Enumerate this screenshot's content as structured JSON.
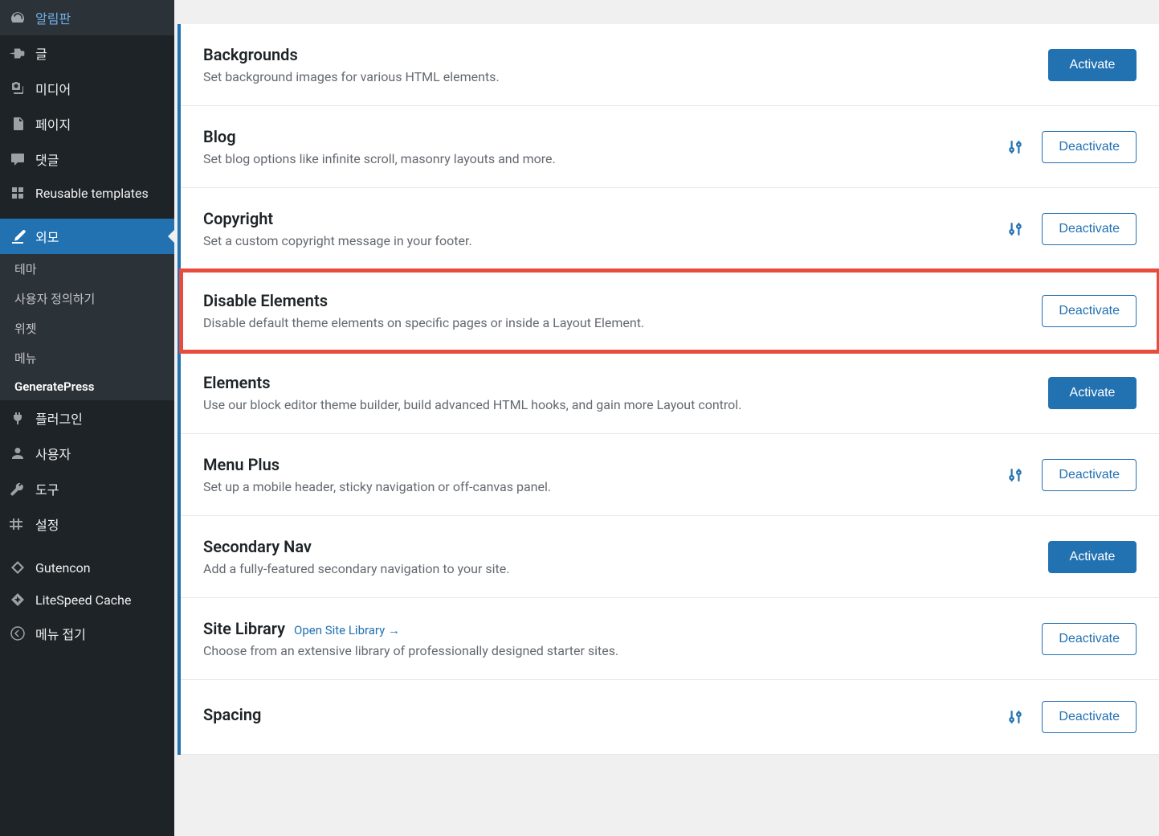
{
  "sidebar": {
    "items": [
      {
        "icon": "dashboard",
        "label": "알림판"
      },
      {
        "icon": "pin",
        "label": "글"
      },
      {
        "icon": "media",
        "label": "미디어"
      },
      {
        "icon": "page",
        "label": "페이지"
      },
      {
        "icon": "comment",
        "label": "댓글"
      },
      {
        "icon": "grid",
        "label": "Reusable templates"
      },
      {
        "icon": "brush",
        "label": "외모",
        "active": true
      },
      {
        "icon": "plugin",
        "label": "플러그인"
      },
      {
        "icon": "user",
        "label": "사용자"
      },
      {
        "icon": "wrench",
        "label": "도구"
      },
      {
        "icon": "settings",
        "label": "설정"
      },
      {
        "icon": "diamond",
        "label": "Gutencon"
      },
      {
        "icon": "bolt",
        "label": "LiteSpeed Cache"
      },
      {
        "icon": "collapse",
        "label": "메뉴 접기"
      }
    ],
    "submenu": [
      {
        "label": "테마"
      },
      {
        "label": "사용자 정의하기"
      },
      {
        "label": "위젯"
      },
      {
        "label": "메뉴"
      },
      {
        "label": "GeneratePress",
        "current": true
      }
    ]
  },
  "buttons": {
    "activate": "Activate",
    "deactivate": "Deactivate"
  },
  "modules": [
    {
      "title": "Backgrounds",
      "desc": "Set background images for various HTML elements.",
      "action": "activate",
      "hasSettings": false,
      "highlighted": false
    },
    {
      "title": "Blog",
      "desc": "Set blog options like infinite scroll, masonry layouts and more.",
      "action": "deactivate",
      "hasSettings": true,
      "highlighted": false
    },
    {
      "title": "Copyright",
      "desc": "Set a custom copyright message in your footer.",
      "action": "deactivate",
      "hasSettings": true,
      "highlighted": false
    },
    {
      "title": "Disable Elements",
      "desc": "Disable default theme elements on specific pages or inside a Layout Element.",
      "action": "deactivate",
      "hasSettings": false,
      "highlighted": true
    },
    {
      "title": "Elements",
      "desc": "Use our block editor theme builder, build advanced HTML hooks, and gain more Layout control.",
      "action": "activate",
      "hasSettings": false,
      "highlighted": false
    },
    {
      "title": "Menu Plus",
      "desc": "Set up a mobile header, sticky navigation or off-canvas panel.",
      "action": "deactivate",
      "hasSettings": true,
      "highlighted": false
    },
    {
      "title": "Secondary Nav",
      "desc": "Add a fully-featured secondary navigation to your site.",
      "action": "activate",
      "hasSettings": false,
      "highlighted": false
    },
    {
      "title": "Site Library",
      "link": "Open Site Library →",
      "desc": "Choose from an extensive library of professionally designed starter sites.",
      "action": "deactivate",
      "hasSettings": false,
      "highlighted": false
    },
    {
      "title": "Spacing",
      "desc": "",
      "action": "deactivate",
      "hasSettings": true,
      "highlighted": false
    }
  ]
}
